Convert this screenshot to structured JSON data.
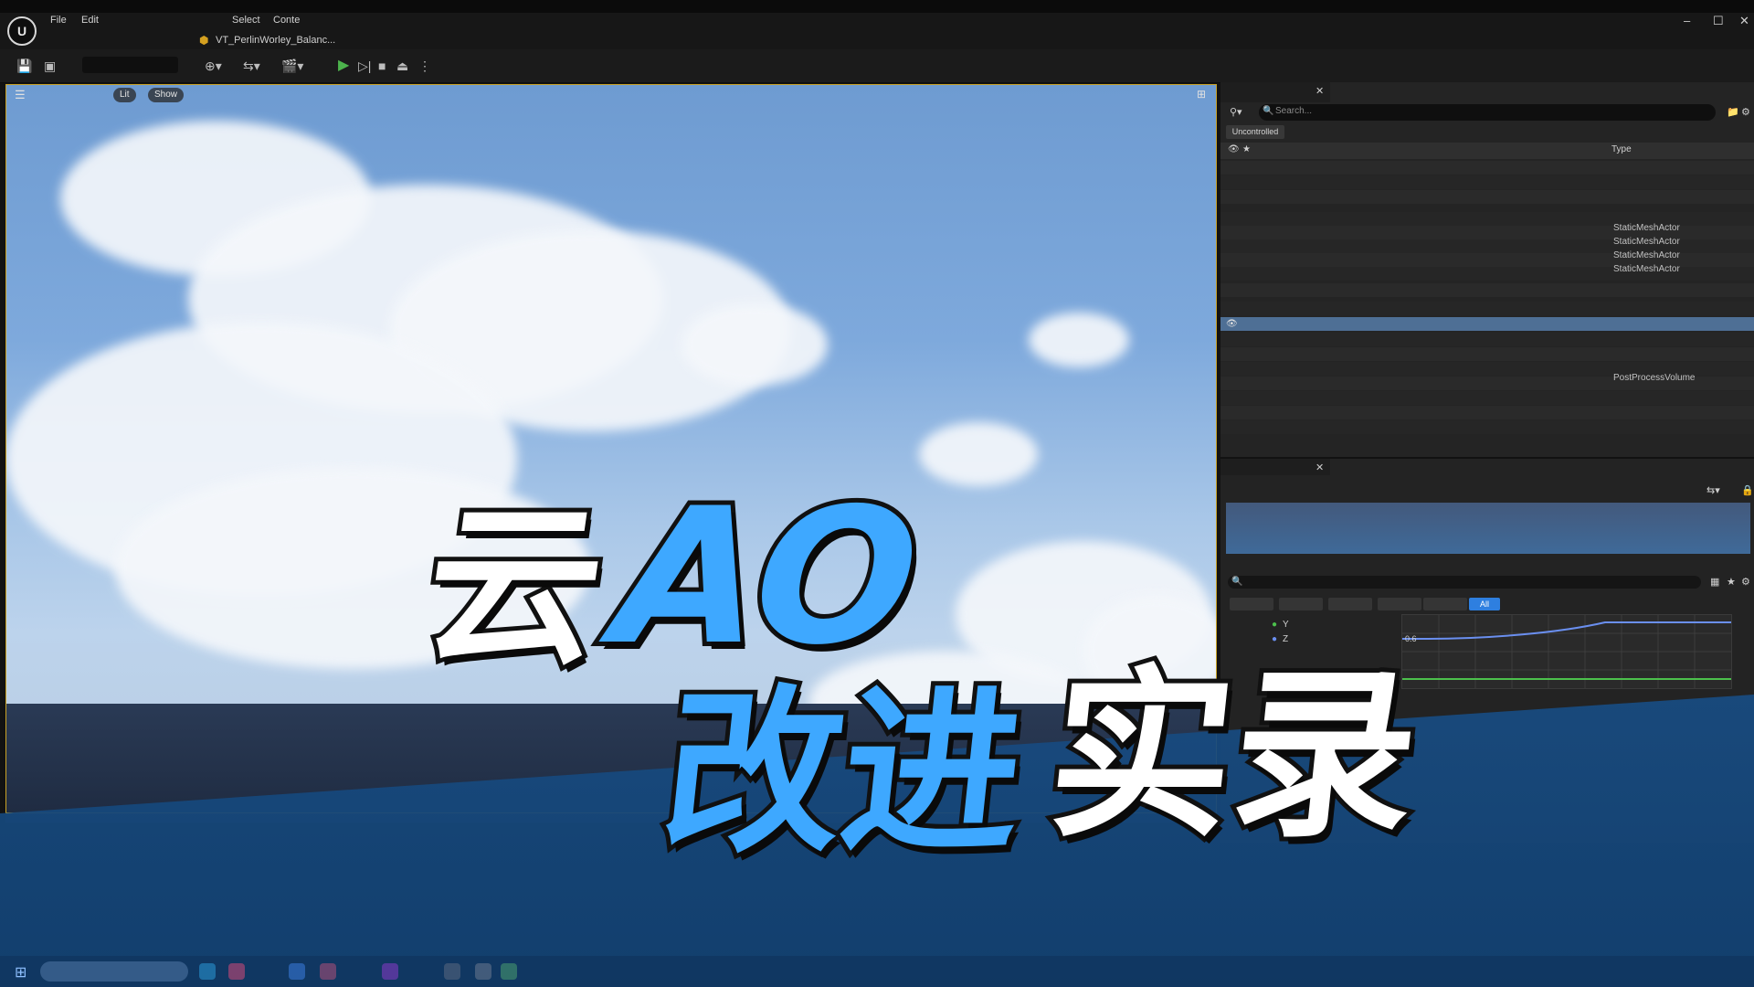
{
  "window": {
    "menu": [
      "File",
      "Edit",
      "Select",
      "Conte"
    ],
    "tab_title": "VT_PerlinWorley_Balanc...",
    "controls": [
      "–",
      "☐",
      "✕"
    ]
  },
  "toolbar": {
    "play_icon": "play-icon",
    "icons": [
      "save-icon",
      "browse-icon",
      "add-actor-icon",
      "snap-icon",
      "cinematics-icon",
      "play-icon",
      "step-icon",
      "stop-icon",
      "eject-icon"
    ]
  },
  "viewport": {
    "pill_lit": "Lit",
    "pill_show": "Show"
  },
  "outliner": {
    "search_placeholder": "Search...",
    "filter_uncontrolled": "Uncontrolled",
    "column_type": "Type",
    "types": [
      "StaticMeshActor",
      "StaticMeshActor",
      "StaticMeshActor",
      "StaticMeshActor",
      "PostProcessVolume"
    ]
  },
  "details": {
    "filter_all": "All",
    "curve_labels": [
      "Y",
      "Z"
    ],
    "curve_value": "0.6"
  },
  "headline": {
    "part1": "云",
    "part2": "AO",
    "part3": "改进",
    "part4": "实录"
  },
  "colors": {
    "accent_blue": "#3ea8ff",
    "band_blue": "#184c82",
    "selection_blue": "#4e6f95"
  }
}
